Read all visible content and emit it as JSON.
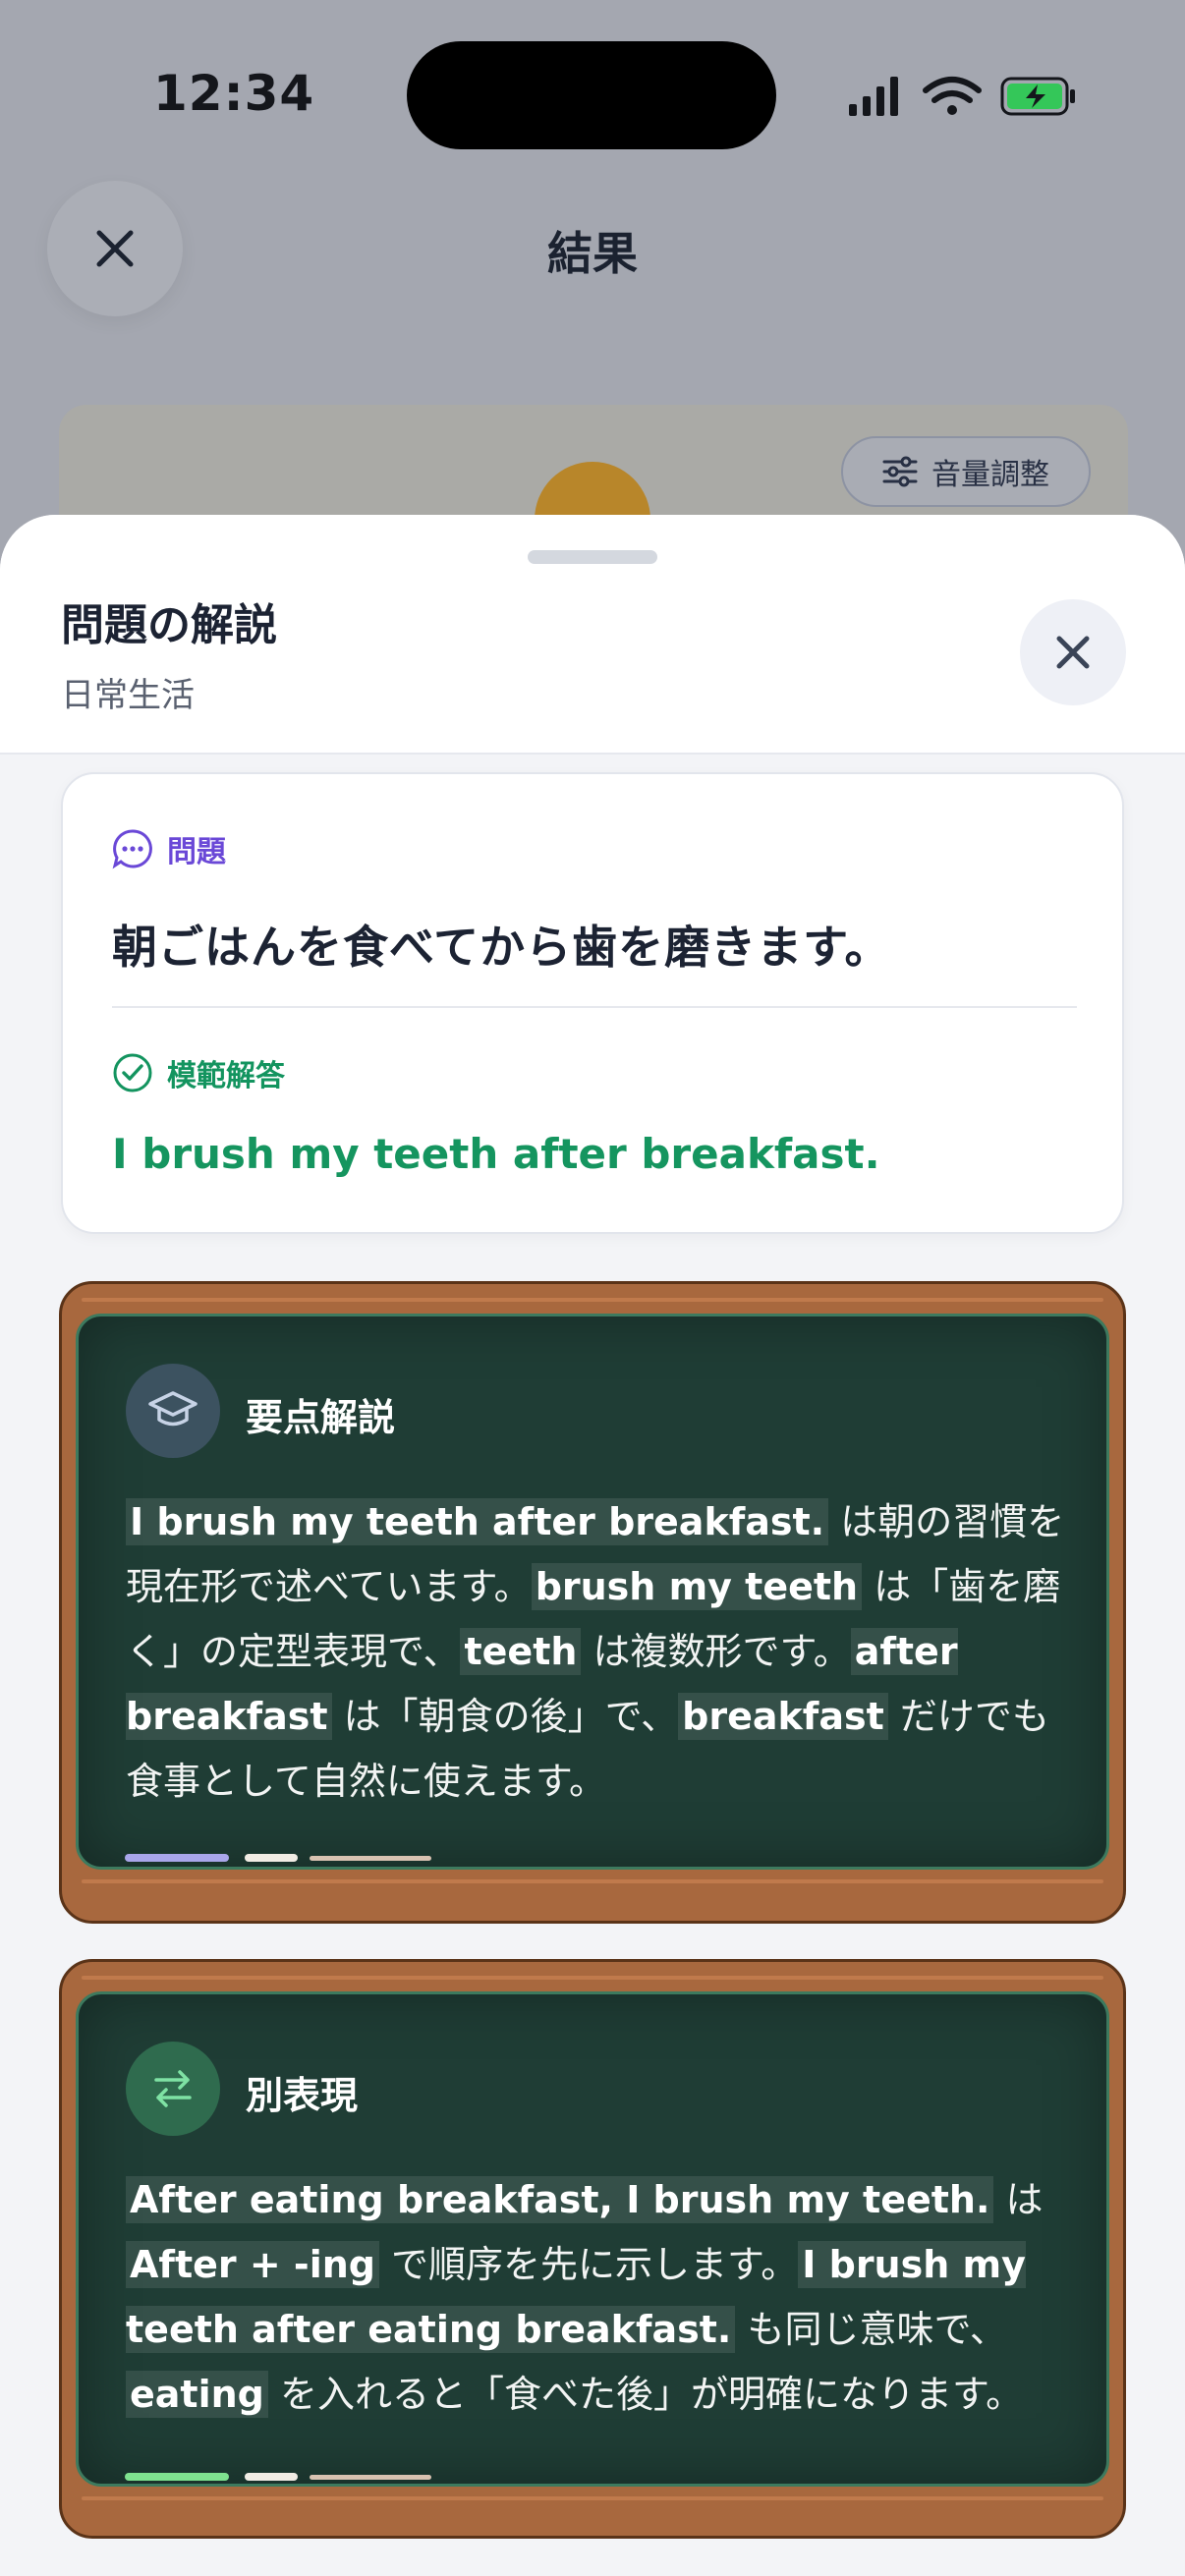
{
  "status_bar": {
    "time": "12:34"
  },
  "background": {
    "title": "結果",
    "volume_button": "音量調整"
  },
  "sheet": {
    "title": "問題の解説",
    "subtitle": "日常生活",
    "question_label": "問題",
    "question": "朝ごはんを食べてから歯を磨きます。",
    "answer_label": "模範解答",
    "answer": "I brush my teeth after breakfast."
  },
  "explanation": {
    "title": "要点解説",
    "segments": [
      {
        "text": "I brush my teeth after breakfast.",
        "bold": true
      },
      {
        "text": " は朝の習慣を現在形で述べています。",
        "bold": false
      },
      {
        "text": "brush my teeth",
        "bold": true
      },
      {
        "text": " は「歯を磨く」の定型表現で、",
        "bold": false
      },
      {
        "text": "teeth",
        "bold": true
      },
      {
        "text": " は複数形です。",
        "bold": false
      },
      {
        "text": "after breakfast",
        "bold": true
      },
      {
        "text": " は「朝食の後」で、",
        "bold": false
      },
      {
        "text": "breakfast",
        "bold": true
      },
      {
        "text": " だけでも食事として自然に使えます。",
        "bold": false
      }
    ]
  },
  "alternative": {
    "title": "別表現",
    "segments": [
      {
        "text": "After eating breakfast, I brush my teeth.",
        "bold": true
      },
      {
        "text": " は ",
        "bold": false
      },
      {
        "text": "After + -ing",
        "bold": true
      },
      {
        "text": " で順序を先に示します。",
        "bold": false
      },
      {
        "text": "I brush my teeth after eating breakfast.",
        "bold": true
      },
      {
        "text": " も同じ意味で、",
        "bold": false
      },
      {
        "text": "eating",
        "bold": true
      },
      {
        "text": " を入れると「食べた後」が明確になります。",
        "bold": false
      }
    ]
  },
  "colors": {
    "question_accent": "#6a48d7",
    "answer_accent": "#15955f",
    "chalkboard": "#1f3d35",
    "frame_wood": "#a8683e"
  }
}
